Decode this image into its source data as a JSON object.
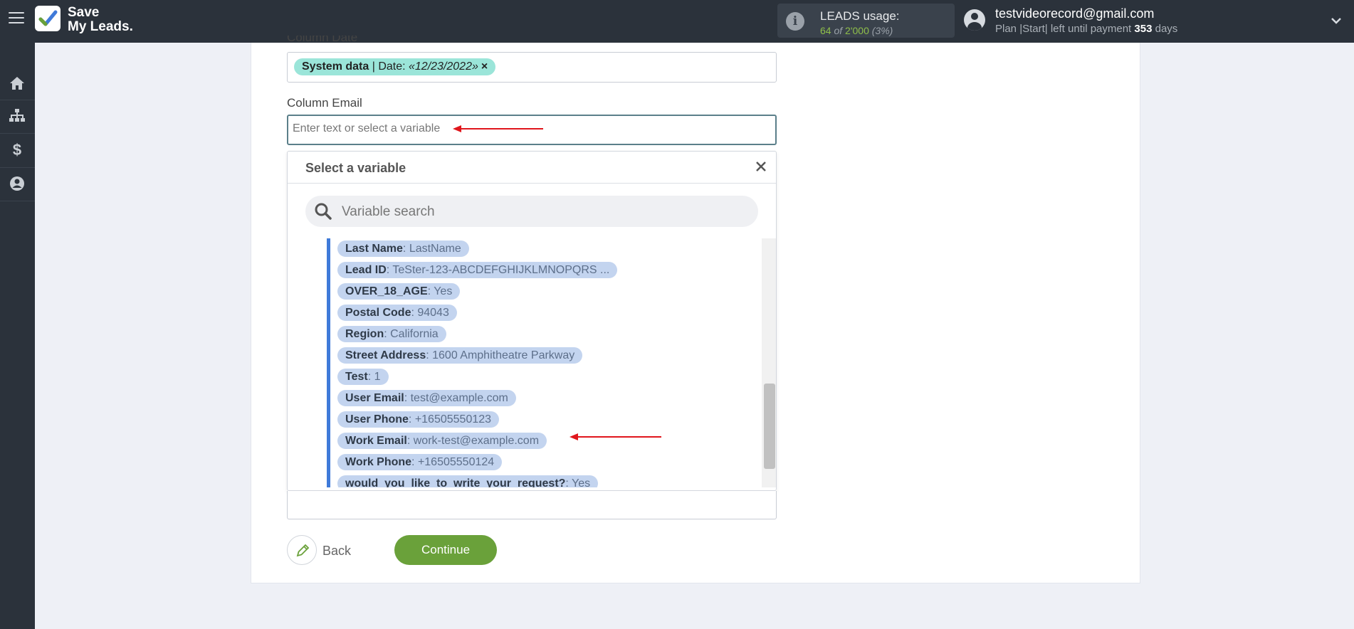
{
  "app": {
    "logo_line1": "Save",
    "logo_line2": "My Leads."
  },
  "usage": {
    "title": "LEADS usage:",
    "used": "64",
    "of": "of",
    "total": "2'000",
    "percent": "(3%)"
  },
  "user": {
    "email": "testvideorecord@gmail.com",
    "plan_prefix": "Plan |Start| left until payment",
    "days": "353",
    "days_suffix": "days"
  },
  "form": {
    "date_label_partial": "Column Date",
    "date_tag": {
      "source": "System data",
      "separator": " | Date: ",
      "value": "«12/23/2022»",
      "remove": "×"
    },
    "email_label": "Column Email",
    "email_placeholder": "Enter text or select a variable"
  },
  "dropdown": {
    "title": "Select a variable",
    "close": "×",
    "search_placeholder": "Variable search",
    "items": [
      {
        "key": "Last Name",
        "value": ": LastName"
      },
      {
        "key": "Lead ID",
        "value": ": TeSter-123-ABCDEFGHIJKLMNOPQRS ..."
      },
      {
        "key": "OVER_18_AGE",
        "value": ": Yes"
      },
      {
        "key": "Postal Code",
        "value": ": 94043"
      },
      {
        "key": "Region",
        "value": ": California"
      },
      {
        "key": "Street Address",
        "value": ": 1600 Amphitheatre Parkway"
      },
      {
        "key": "Test",
        "value": ": 1"
      },
      {
        "key": "User Email",
        "value": ": test@example.com"
      },
      {
        "key": "User Phone",
        "value": ": +16505550123"
      },
      {
        "key": "Work Email",
        "value": ": work-test@example.com"
      },
      {
        "key": "Work Phone",
        "value": ": +16505550124"
      },
      {
        "key": "would_you_like_to_write_your_request?",
        "value": ": Yes"
      }
    ]
  },
  "actions": {
    "back": "Back",
    "continue": "Continue"
  },
  "colors": {
    "topbar": "#2b323b",
    "accent_green": "#6aa13a",
    "tag_teal": "#9be5d9",
    "variable_blue": "#c3d4ef",
    "list_border": "#3f7ad9",
    "arrow_red": "#e0161c"
  }
}
